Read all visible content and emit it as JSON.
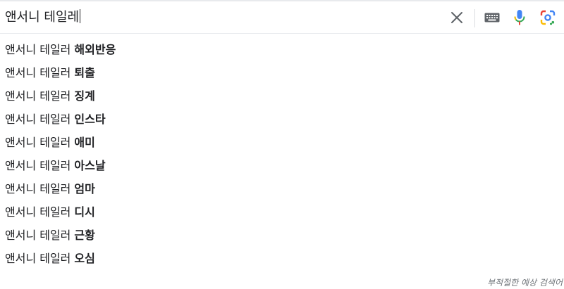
{
  "search": {
    "query": "앤서니 테일레",
    "buttons": {
      "clear_icon": "close-icon",
      "keyboard_icon": "keyboard-icon",
      "voice_icon": "microphone-icon",
      "lens_icon": "camera-lens-icon"
    }
  },
  "suggestions": [
    {
      "prefix": "앤서니 테일러",
      "suffix": "해외반응"
    },
    {
      "prefix": "앤서니 테일러",
      "suffix": "퇴출"
    },
    {
      "prefix": "앤서니 테일러",
      "suffix": "징계"
    },
    {
      "prefix": "앤서니 테일러",
      "suffix": "인스타"
    },
    {
      "prefix": "앤서니 테일러",
      "suffix": "애미"
    },
    {
      "prefix": "앤서니 테일러",
      "suffix": "아스날"
    },
    {
      "prefix": "앤서니 테일러",
      "suffix": "엄마"
    },
    {
      "prefix": "앤서니 테일러",
      "suffix": "디시"
    },
    {
      "prefix": "앤서니 테일러",
      "suffix": "근황"
    },
    {
      "prefix": "앤서니 테일러",
      "suffix": "오심"
    }
  ],
  "footer": {
    "report_label": "부적절한 예상 검색어"
  },
  "colors": {
    "google_blue": "#4285F4",
    "google_red": "#EA4335",
    "google_yellow": "#FBBC04",
    "google_green": "#34A853",
    "icon_gray": "#5f6368"
  }
}
